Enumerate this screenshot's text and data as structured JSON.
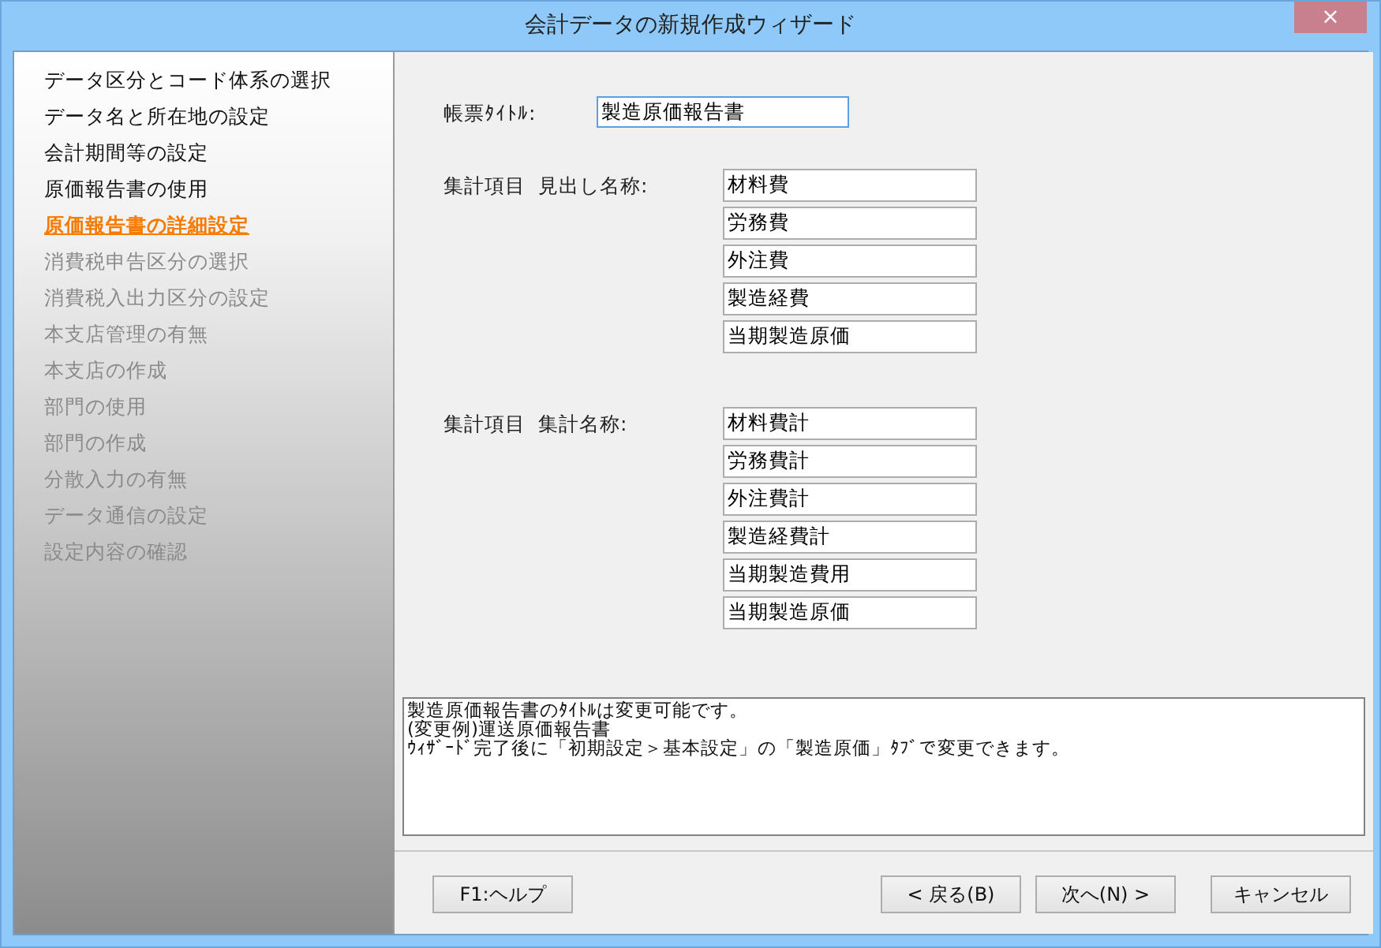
{
  "window": {
    "title": "会計データの新規作成ウィザード",
    "close": "×"
  },
  "steps": [
    {
      "label": "データ区分とコード体系の選択",
      "selected": false,
      "disabled": false
    },
    {
      "label": "データ名と所在地の設定",
      "selected": false,
      "disabled": false
    },
    {
      "label": "会計期間等の設定",
      "selected": false,
      "disabled": false
    },
    {
      "label": "原価報告書の使用",
      "selected": false,
      "disabled": false
    },
    {
      "label": "原価報告書の詳細設定",
      "selected": true,
      "disabled": false
    },
    {
      "label": "消費税申告区分の選択",
      "selected": false,
      "disabled": true
    },
    {
      "label": "消費税入出力区分の設定",
      "selected": false,
      "disabled": true
    },
    {
      "label": "本支店管理の有無",
      "selected": false,
      "disabled": true
    },
    {
      "label": "本支店の作成",
      "selected": false,
      "disabled": true
    },
    {
      "label": "部門の使用",
      "selected": false,
      "disabled": true
    },
    {
      "label": "部門の作成",
      "selected": false,
      "disabled": true
    },
    {
      "label": "分散入力の有無",
      "selected": false,
      "disabled": true
    },
    {
      "label": "データ通信の設定",
      "selected": false,
      "disabled": true
    },
    {
      "label": "設定内容の確認",
      "selected": false,
      "disabled": true
    }
  ],
  "title_field": {
    "label": "帳票ﾀｲﾄﾙ:",
    "value": "製造原価報告書"
  },
  "groups": [
    {
      "label": "集計項目  見出し名称:",
      "values": [
        "材料費",
        "労務費",
        "外注費",
        "製造経費",
        "当期製造原価"
      ]
    },
    {
      "label": "集計項目  集計名称:",
      "values": [
        "材料費計",
        "労務費計",
        "外注費計",
        "製造経費計",
        "当期製造費用",
        "当期製造原価"
      ]
    }
  ],
  "note": [
    "製造原価報告書のﾀｲﾄﾙは変更可能です。",
    "(変更例)運送原価報告書",
    "ｳｨｻﾞｰﾄﾞ完了後に「初期設定＞基本設定」の「製造原価」ﾀﾌﾞで変更できます。"
  ],
  "buttons": {
    "help": "F1:ヘルプ",
    "back": "< 戻る(B)",
    "next": "次へ(N) >",
    "cancel": "キャンセル"
  }
}
